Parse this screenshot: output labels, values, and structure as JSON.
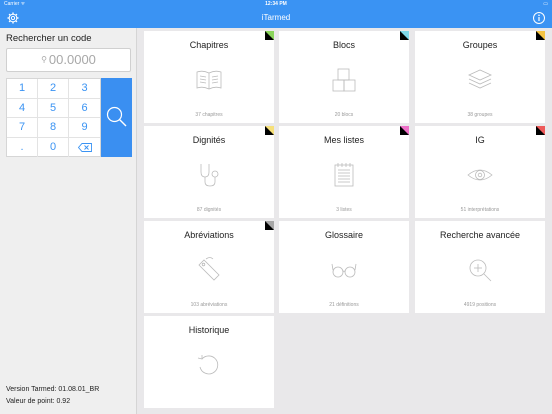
{
  "status": {
    "carrier": "Carrier ᯤ",
    "time": "12:34 PM",
    "battery": "▭"
  },
  "nav": {
    "title": "iTarmed",
    "left_icon": "gear-icon",
    "right_icon": "info-icon"
  },
  "search": {
    "label": "Rechercher un code",
    "placeholder": "00.0000",
    "keys": [
      "1",
      "2",
      "3",
      "4",
      "5",
      "6",
      "7",
      "8",
      "9",
      ".",
      "0",
      "⌫"
    ]
  },
  "footer": {
    "version": "Version Tarmed: 01.08.01_BR",
    "point_value": "Valeur de point: 0.92"
  },
  "colors": {
    "accent": "#3a93f3"
  },
  "tiles": [
    {
      "title": "Chapitres",
      "count": "37 chapitres",
      "icon": "book-icon",
      "corner": "#8ad45b"
    },
    {
      "title": "Blocs",
      "count": "20 blocs",
      "icon": "blocks-icon",
      "corner": "#7fd7e8"
    },
    {
      "title": "Groupes",
      "count": "38 groupes",
      "icon": "layers-icon",
      "corner": "#f5c342"
    },
    {
      "title": "Dignités",
      "count": "87 dignités",
      "icon": "stethoscope-icon",
      "corner": "#f6e07a"
    },
    {
      "title": "Mes listes",
      "count": "3 listes",
      "icon": "notepad-icon",
      "corner": "#ee70c8"
    },
    {
      "title": "IG",
      "count": "51 interprétations",
      "icon": "eye-icon",
      "corner": "#ee5a5a"
    },
    {
      "title": "Abréviations",
      "count": "103 abréviations",
      "icon": "tag-icon",
      "corner": "#a7a7a7"
    },
    {
      "title": "Glossaire",
      "count": "21 définitions",
      "icon": "glasses-icon",
      "corner": ""
    },
    {
      "title": "Recherche avancée",
      "count": "4919 positions",
      "icon": "zoom-in-icon",
      "corner": ""
    },
    {
      "title": "Historique",
      "count": "",
      "icon": "history-icon",
      "corner": ""
    }
  ]
}
